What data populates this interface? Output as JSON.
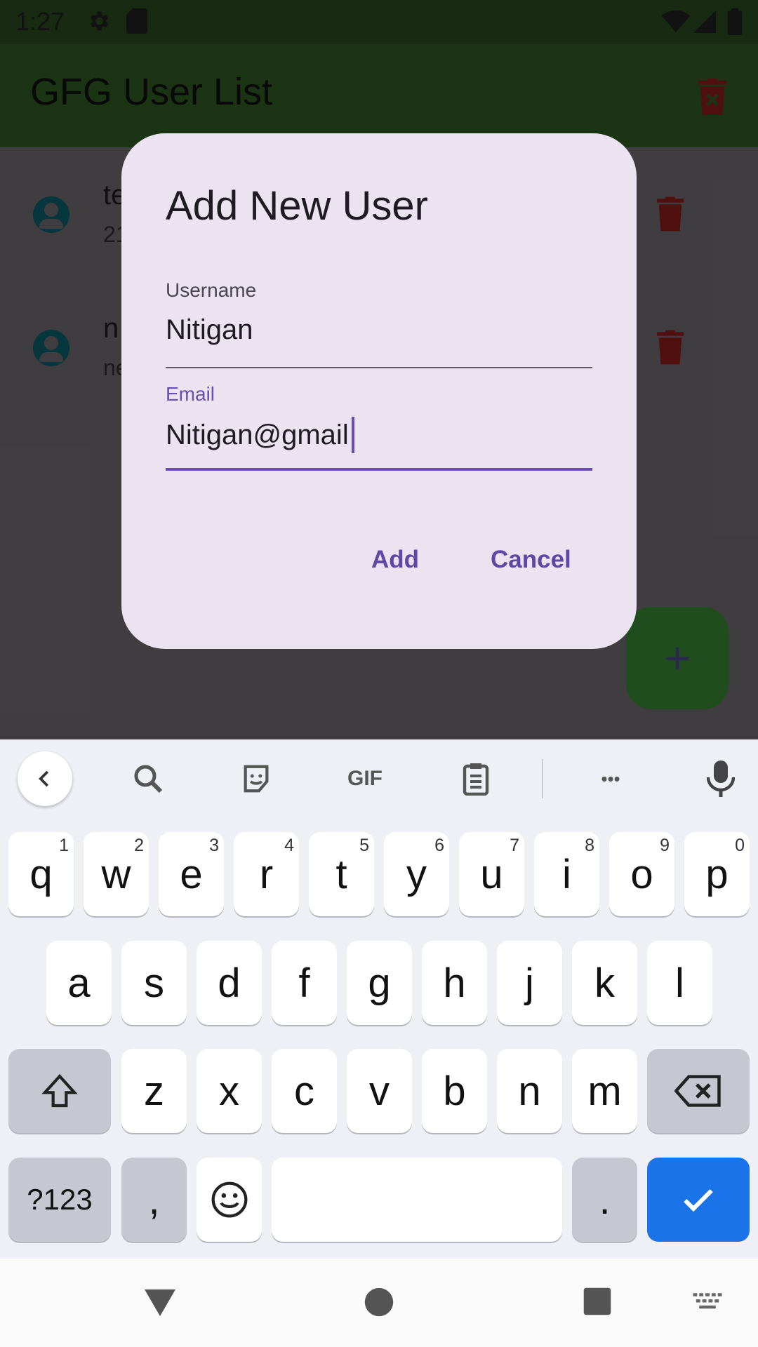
{
  "status_bar": {
    "time": "1:27"
  },
  "app_bar": {
    "title": "GFG User List"
  },
  "users": [
    {
      "name_partial": "te",
      "sub_partial": "21"
    },
    {
      "name_partial": "n",
      "sub_partial": "ne"
    }
  ],
  "dialog": {
    "title": "Add New User",
    "username": {
      "label": "Username",
      "value": "Nitigan"
    },
    "email": {
      "label": "Email",
      "value": "Nitigan@gmail"
    },
    "add_label": "Add",
    "cancel_label": "Cancel"
  },
  "fab": {
    "label": "+"
  },
  "keyboard": {
    "toolbar": {
      "gif_label": "GIF",
      "more_label": "•••"
    },
    "row1": [
      {
        "k": "q",
        "h": "1"
      },
      {
        "k": "w",
        "h": "2"
      },
      {
        "k": "e",
        "h": "3"
      },
      {
        "k": "r",
        "h": "4"
      },
      {
        "k": "t",
        "h": "5"
      },
      {
        "k": "y",
        "h": "6"
      },
      {
        "k": "u",
        "h": "7"
      },
      {
        "k": "i",
        "h": "8"
      },
      {
        "k": "o",
        "h": "9"
      },
      {
        "k": "p",
        "h": "0"
      }
    ],
    "row2": [
      "a",
      "s",
      "d",
      "f",
      "g",
      "h",
      "j",
      "k",
      "l"
    ],
    "row3": [
      "z",
      "x",
      "c",
      "v",
      "b",
      "n",
      "m"
    ],
    "symbols_label": "?123",
    "comma_label": ",",
    "period_label": "."
  },
  "colors": {
    "app_bar": "#2f5a21",
    "delete_icon": "#8b1d1d",
    "dialog_bg": "#ebe3ef",
    "accent": "#5e48a6",
    "keyboard_done": "#1a73e8"
  }
}
